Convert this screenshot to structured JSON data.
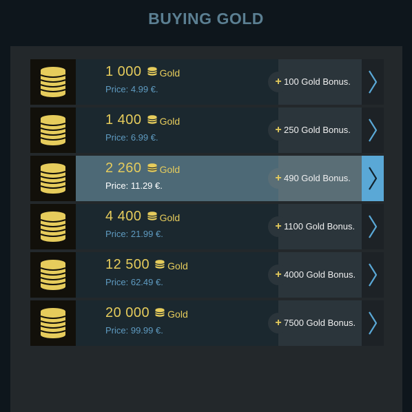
{
  "header": {
    "title": "BUYING GOLD"
  },
  "colors": {
    "gold": "#e6cc5c",
    "price_blue": "#5f9bc1",
    "selected_accent": "#5aa8d6"
  },
  "offers": [
    {
      "amount": "1 000",
      "unit": "Gold",
      "price": "Price: 4.99 €.",
      "bonus_sign": "+",
      "bonus": "100 Gold Bonus.",
      "icon": "coin-stack-icon",
      "arrow_icon": "chevron-right-icon",
      "selected": false
    },
    {
      "amount": "1 400",
      "unit": "Gold",
      "price": "Price: 6.99 €.",
      "bonus_sign": "+",
      "bonus": "250 Gold Bonus.",
      "icon": "coin-stack-icon",
      "arrow_icon": "chevron-right-icon",
      "selected": false
    },
    {
      "amount": "2 260",
      "unit": "Gold",
      "price": "Price: 11.29 €.",
      "bonus_sign": "+",
      "bonus": "490 Gold Bonus.",
      "icon": "coin-stack-icon",
      "arrow_icon": "chevron-right-icon",
      "selected": true
    },
    {
      "amount": "4 400",
      "unit": "Gold",
      "price": "Price: 21.99 €.",
      "bonus_sign": "+",
      "bonus": "1100 Gold Bonus.",
      "icon": "coin-stack-icon",
      "arrow_icon": "chevron-right-icon",
      "selected": false
    },
    {
      "amount": "12 500",
      "unit": "Gold",
      "price": "Price: 62.49 €.",
      "bonus_sign": "+",
      "bonus": "4000 Gold Bonus.",
      "icon": "coin-stack-icon",
      "arrow_icon": "chevron-right-icon",
      "selected": false
    },
    {
      "amount": "20 000",
      "unit": "Gold",
      "price": "Price: 99.99 €.",
      "bonus_sign": "+",
      "bonus": "7500 Gold Bonus.",
      "icon": "coin-stack-icon",
      "arrow_icon": "chevron-right-icon",
      "selected": false
    }
  ]
}
